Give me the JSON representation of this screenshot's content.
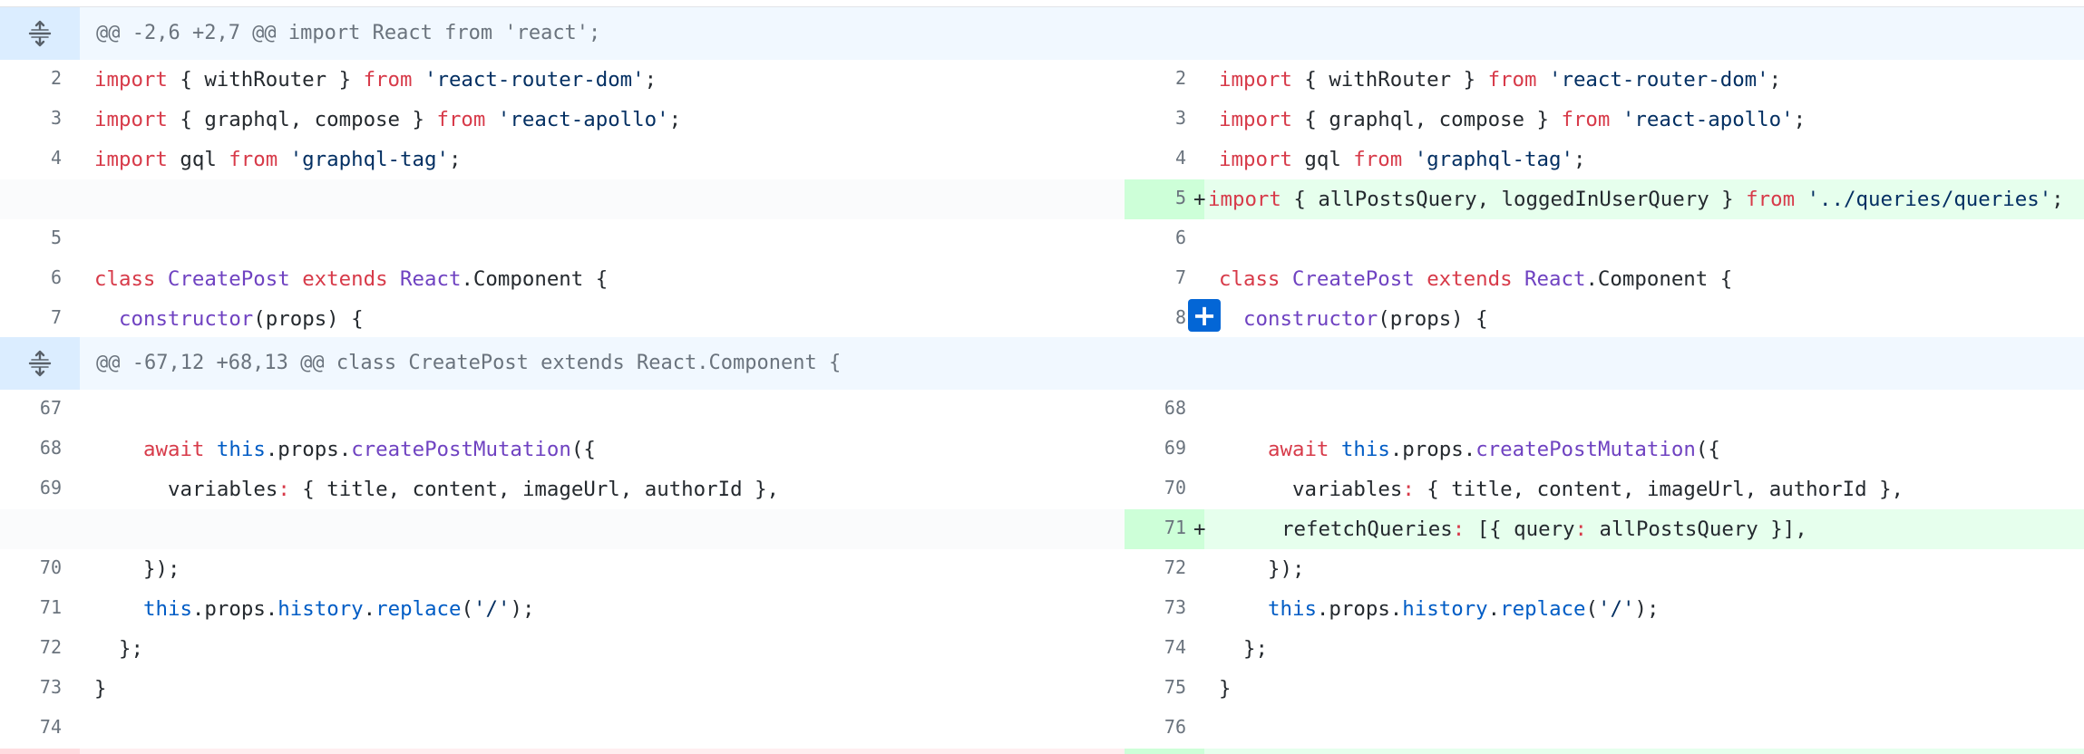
{
  "hunks": [
    {
      "text": "@@ -2,6 +2,7 @@ import React from 'react';"
    },
    {
      "text": "@@ -67,12 +68,13 @@ class CreatePost extends React.Component {"
    }
  ],
  "rows": [
    {
      "l": {
        "num": "2",
        "indent": 0,
        "tokens": [
          [
            "k",
            "import"
          ],
          [
            "p",
            " { withRouter } "
          ],
          [
            "k",
            "from"
          ],
          [
            "p",
            " "
          ],
          [
            "s",
            "'react-router-dom'"
          ],
          [
            "p",
            ";"
          ]
        ]
      },
      "r": {
        "num": "2",
        "indent": 0,
        "tokens": [
          [
            "k",
            "import"
          ],
          [
            "p",
            " { withRouter } "
          ],
          [
            "k",
            "from"
          ],
          [
            "p",
            " "
          ],
          [
            "s",
            "'react-router-dom'"
          ],
          [
            "p",
            ";"
          ]
        ]
      }
    },
    {
      "l": {
        "num": "3",
        "indent": 0,
        "tokens": [
          [
            "k",
            "import"
          ],
          [
            "p",
            " { graphql, compose } "
          ],
          [
            "k",
            "from"
          ],
          [
            "p",
            " "
          ],
          [
            "s",
            "'react-apollo'"
          ],
          [
            "p",
            ";"
          ]
        ]
      },
      "r": {
        "num": "3",
        "indent": 0,
        "tokens": [
          [
            "k",
            "import"
          ],
          [
            "p",
            " { graphql, compose } "
          ],
          [
            "k",
            "from"
          ],
          [
            "p",
            " "
          ],
          [
            "s",
            "'react-apollo'"
          ],
          [
            "p",
            ";"
          ]
        ]
      }
    },
    {
      "l": {
        "num": "4",
        "indent": 0,
        "tokens": [
          [
            "k",
            "import"
          ],
          [
            "p",
            " gql "
          ],
          [
            "k",
            "from"
          ],
          [
            "p",
            " "
          ],
          [
            "s",
            "'graphql-tag'"
          ],
          [
            "p",
            ";"
          ]
        ]
      },
      "r": {
        "num": "4",
        "indent": 0,
        "tokens": [
          [
            "k",
            "import"
          ],
          [
            "p",
            " gql "
          ],
          [
            "k",
            "from"
          ],
          [
            "p",
            " "
          ],
          [
            "s",
            "'graphql-tag'"
          ],
          [
            "p",
            ";"
          ]
        ]
      }
    },
    {
      "l": null,
      "r": {
        "num": "5",
        "add": true,
        "marker": "+",
        "indent": 0,
        "tokens": [
          [
            "k",
            "import"
          ],
          [
            "p",
            " { allPostsQuery, loggedInUserQuery } "
          ],
          [
            "k",
            "from"
          ],
          [
            "p",
            " "
          ],
          [
            "s",
            "'../queries/queries'"
          ],
          [
            "p",
            ";"
          ]
        ]
      }
    },
    {
      "l": {
        "num": "5",
        "indent": 0,
        "tokens": []
      },
      "r": {
        "num": "6",
        "indent": 0,
        "tokens": []
      }
    },
    {
      "l": {
        "num": "6",
        "indent": 0,
        "tokens": [
          [
            "k",
            "class"
          ],
          [
            "p",
            " "
          ],
          [
            "e",
            "CreatePost"
          ],
          [
            "p",
            " "
          ],
          [
            "k",
            "extends"
          ],
          [
            "p",
            " "
          ],
          [
            "e",
            "React"
          ],
          [
            "p",
            ".Component {"
          ]
        ]
      },
      "r": {
        "num": "7",
        "indent": 0,
        "tokens": [
          [
            "k",
            "class"
          ],
          [
            "p",
            " "
          ],
          [
            "e",
            "CreatePost"
          ],
          [
            "p",
            " "
          ],
          [
            "k",
            "extends"
          ],
          [
            "p",
            " "
          ],
          [
            "e",
            "React"
          ],
          [
            "p",
            ".Component {"
          ]
        ]
      }
    },
    {
      "l": {
        "num": "7",
        "indent": 1,
        "tokens": [
          [
            "e",
            "constructor"
          ],
          [
            "p",
            "(props) {"
          ]
        ]
      },
      "r": {
        "num": "8",
        "indent": 1,
        "tokens": [
          [
            "e",
            "constructor"
          ],
          [
            "p",
            "(props) {"
          ]
        ]
      }
    },
    {
      "l": {
        "num": "67",
        "indent": 0,
        "tokens": []
      },
      "r": {
        "num": "68",
        "indent": 0,
        "tokens": []
      }
    },
    {
      "l": {
        "num": "68",
        "indent": 2,
        "tokens": [
          [
            "k",
            "await"
          ],
          [
            "p",
            " "
          ],
          [
            "c1",
            "this"
          ],
          [
            "p",
            ".props."
          ],
          [
            "e",
            "createPostMutation"
          ],
          [
            "p",
            "({"
          ]
        ]
      },
      "r": {
        "num": "69",
        "indent": 2,
        "tokens": [
          [
            "k",
            "await"
          ],
          [
            "p",
            " "
          ],
          [
            "c1",
            "this"
          ],
          [
            "p",
            ".props."
          ],
          [
            "e",
            "createPostMutation"
          ],
          [
            "p",
            "({"
          ]
        ]
      }
    },
    {
      "l": {
        "num": "69",
        "indent": 3,
        "tokens": [
          [
            "p",
            "variables"
          ],
          [
            "k",
            ":"
          ],
          [
            "p",
            " { title, content, imageUrl, authorId },"
          ]
        ]
      },
      "r": {
        "num": "70",
        "indent": 3,
        "tokens": [
          [
            "p",
            "variables"
          ],
          [
            "k",
            ":"
          ],
          [
            "p",
            " { title, content, imageUrl, authorId },"
          ]
        ]
      }
    },
    {
      "l": null,
      "r": {
        "num": "71",
        "add": true,
        "marker": "+",
        "indent": 3,
        "tokens": [
          [
            "p",
            "refetchQueries"
          ],
          [
            "k",
            ":"
          ],
          [
            "p",
            " [{ query"
          ],
          [
            "k",
            ":"
          ],
          [
            "p",
            " allPostsQuery }],"
          ]
        ]
      }
    },
    {
      "l": {
        "num": "70",
        "indent": 2,
        "tokens": [
          [
            "p",
            "});"
          ]
        ]
      },
      "r": {
        "num": "72",
        "indent": 2,
        "tokens": [
          [
            "p",
            "});"
          ]
        ]
      }
    },
    {
      "l": {
        "num": "71",
        "indent": 2,
        "tokens": [
          [
            "c1",
            "this"
          ],
          [
            "p",
            ".props."
          ],
          [
            "c1",
            "history"
          ],
          [
            "p",
            "."
          ],
          [
            "c1",
            "replace"
          ],
          [
            "p",
            "("
          ],
          [
            "s",
            "'/'"
          ],
          [
            "p",
            ");"
          ]
        ]
      },
      "r": {
        "num": "73",
        "indent": 2,
        "tokens": [
          [
            "c1",
            "this"
          ],
          [
            "p",
            ".props."
          ],
          [
            "c1",
            "history"
          ],
          [
            "p",
            "."
          ],
          [
            "c1",
            "replace"
          ],
          [
            "p",
            "("
          ],
          [
            "s",
            "'/'"
          ],
          [
            "p",
            ");"
          ]
        ]
      }
    },
    {
      "l": {
        "num": "72",
        "indent": 1,
        "tokens": [
          [
            "p",
            "};"
          ]
        ]
      },
      "r": {
        "num": "74",
        "indent": 1,
        "tokens": [
          [
            "p",
            "};"
          ]
        ]
      }
    },
    {
      "l": {
        "num": "73",
        "indent": 0,
        "tokens": [
          [
            "p",
            "}"
          ]
        ]
      },
      "r": {
        "num": "75",
        "indent": 0,
        "tokens": [
          [
            "p",
            "}"
          ]
        ]
      }
    },
    {
      "l": {
        "num": "74",
        "indent": 0,
        "tokens": []
      },
      "r": {
        "num": "76",
        "indent": 0,
        "tokens": []
      }
    }
  ],
  "add_line_button": {
    "label": "+"
  },
  "icons": {
    "expand": "unfold-expand-icon"
  },
  "colors": {
    "keyword": "#d73a49",
    "string": "#032f62",
    "entity": "#6f42c1",
    "constant": "#005cc5",
    "addition_bg": "#e6ffed",
    "addition_num_bg": "#cdffd8",
    "hunk_bg": "#f1f8ff"
  }
}
